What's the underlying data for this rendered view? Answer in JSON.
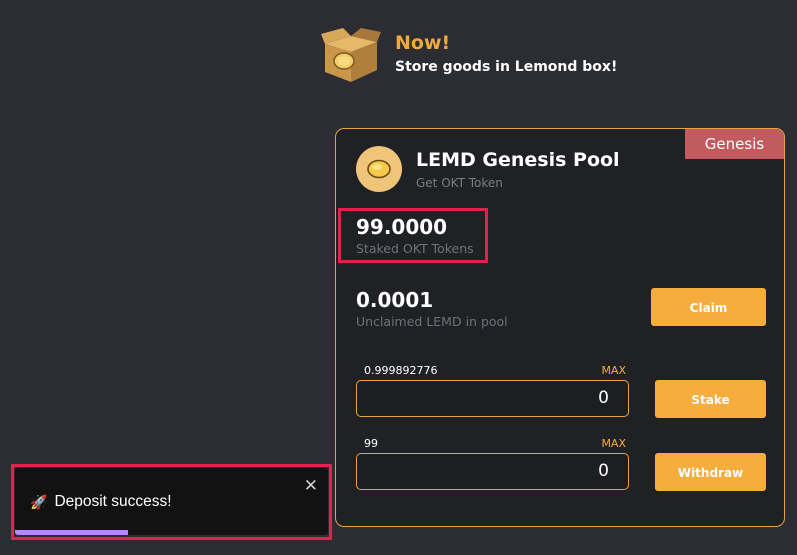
{
  "promo": {
    "title": "Now!",
    "subtitle": "Store goods in Lemond box!",
    "icon": "lemon-box-icon"
  },
  "pool": {
    "badge": "Genesis",
    "title": "LEMD Genesis Pool",
    "subtitle": "Get OKT Token",
    "icon": "lemon-coin-icon",
    "staked": {
      "value": "99.0000",
      "label": "Staked OKT Tokens"
    },
    "unclaimed": {
      "value": "0.0001",
      "label": "Unclaimed LEMD in pool"
    },
    "claim_label": "Claim",
    "stake": {
      "balance": "0.999892776",
      "max_label": "MAX",
      "value": "0",
      "button": "Stake"
    },
    "withdraw": {
      "balance": "99",
      "max_label": "MAX",
      "value": "0",
      "button": "Withdraw"
    }
  },
  "toast": {
    "icon": "rocket-icon",
    "icon_glyph": "🚀",
    "message": "Deposit success!",
    "close_glyph": "✕",
    "progress": 0.36
  },
  "colors": {
    "accent": "#f5ad3e",
    "badge": "#c25b5f",
    "highlight": "#e0234e",
    "toast_progress": "#bb86fc"
  }
}
